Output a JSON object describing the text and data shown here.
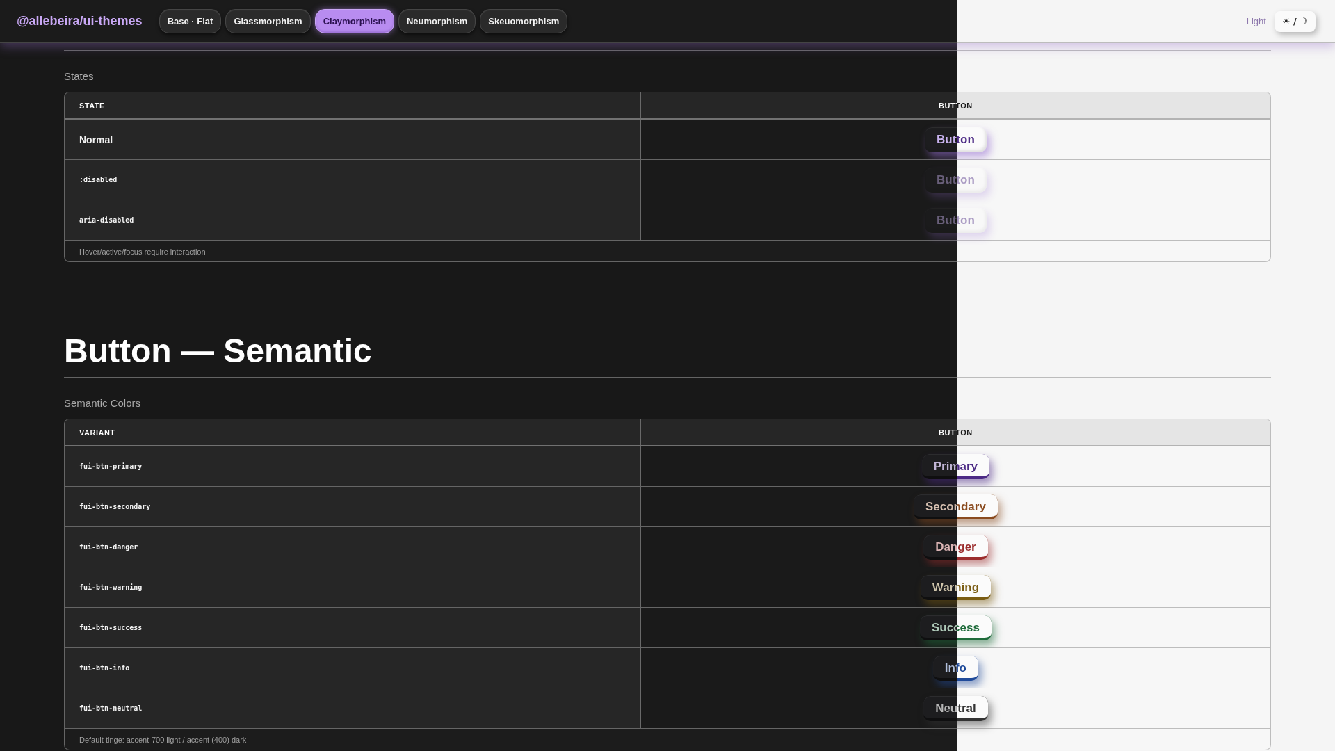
{
  "header": {
    "logo": "@allebeira/ui-themes",
    "tabs": [
      {
        "label": "Base · Flat",
        "selected": false
      },
      {
        "label": "Glassmorphism",
        "selected": false
      },
      {
        "label": "Claymorphism",
        "selected": true
      },
      {
        "label": "Neumorphism",
        "selected": false
      },
      {
        "label": "Skeuomorphism",
        "selected": false
      }
    ],
    "mode_label": "Light",
    "theme_toggle": "☀ / ☽"
  },
  "states": {
    "title": "States",
    "columns": [
      "STATE",
      "BUTTON"
    ],
    "rows": [
      {
        "kind": "text",
        "label": "Normal",
        "button": "Button",
        "disabled": false
      },
      {
        "kind": "code",
        "label": ":disabled",
        "button": "Button",
        "disabled": true
      },
      {
        "kind": "code",
        "label": "aria-disabled",
        "button": "Button",
        "disabled": true
      }
    ],
    "note": "Hover/active/focus require interaction"
  },
  "semantic": {
    "heading": "Button — Semantic",
    "title": "Semantic Colors",
    "columns": [
      "VARIANT",
      "BUTTON"
    ],
    "rows": [
      {
        "label": "fui-btn-primary",
        "button": "Primary",
        "color": "#4c2a85"
      },
      {
        "label": "fui-btn-secondary",
        "button": "Secondary",
        "color": "#8a4b1f"
      },
      {
        "label": "fui-btn-danger",
        "button": "Danger",
        "color": "#9b2c2c"
      },
      {
        "label": "fui-btn-warning",
        "button": "Warning",
        "color": "#7a5c12"
      },
      {
        "label": "fui-btn-success",
        "button": "Success",
        "color": "#1e6b3a"
      },
      {
        "label": "fui-btn-info",
        "button": "Info",
        "color": "#1f4a9a"
      },
      {
        "label": "fui-btn-neutral",
        "button": "Neutral",
        "color": "#333333"
      }
    ],
    "note": "Default tinge: accent-700 light / accent (400) dark"
  }
}
